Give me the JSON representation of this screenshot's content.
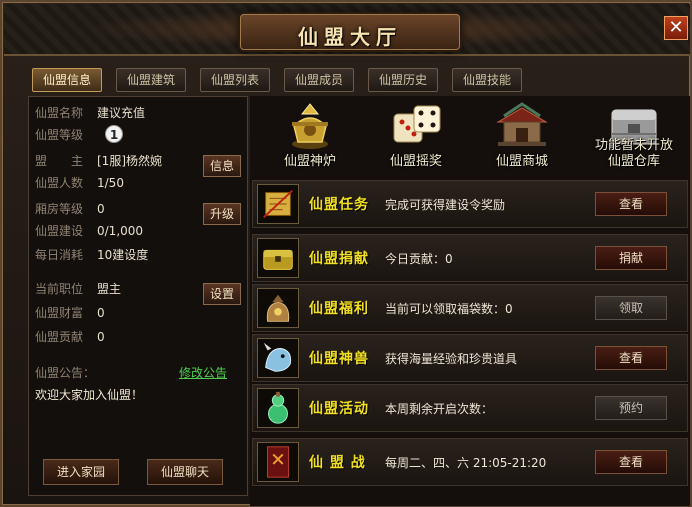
{
  "window": {
    "title": "仙盟大厅",
    "close_label": "✕"
  },
  "tabs": [
    {
      "label": "仙盟信息",
      "active": true
    },
    {
      "label": "仙盟建筑",
      "active": false
    },
    {
      "label": "仙盟列表",
      "active": false
    },
    {
      "label": "仙盟成员",
      "active": false
    },
    {
      "label": "仙盟历史",
      "active": false
    },
    {
      "label": "仙盟技能",
      "active": false
    }
  ],
  "info": {
    "name": {
      "label": "仙盟名称",
      "value": "建议充值"
    },
    "level": {
      "label": "仙盟等级",
      "value": "1"
    },
    "leader": {
      "label": "盟　　主",
      "value": "[1服]杨然婉",
      "button": "信息"
    },
    "members": {
      "label": "仙盟人数",
      "value": "1/50"
    },
    "room_level": {
      "label": "厢房等级",
      "value": "0",
      "button": "升级"
    },
    "construction": {
      "label": "仙盟建设",
      "value": "0/1,000"
    },
    "daily_cost": {
      "label": "每日消耗",
      "value": "10建设度"
    },
    "position": {
      "label": "当前职位",
      "value": "盟主",
      "button": "设置"
    },
    "wealth": {
      "label": "仙盟财富",
      "value": "0"
    },
    "contribution": {
      "label": "仙盟贡献",
      "value": "0"
    },
    "notice": {
      "label": "仙盟公告：",
      "edit_label": "修改公告",
      "text": "欢迎大家加入仙盟！"
    },
    "enter_home_label": "进入家园",
    "chat_label": "仙盟聊天"
  },
  "facilities": [
    {
      "name": "仙盟神炉",
      "icon": "censer-icon"
    },
    {
      "name": "仙盟摇奖",
      "icon": "dice-icon"
    },
    {
      "name": "仙盟商城",
      "icon": "shop-icon"
    },
    {
      "name_line1": "功能暂未开放",
      "name_line2": "仙盟仓库",
      "icon": "warehouse-icon"
    }
  ],
  "features": [
    {
      "name": "仙盟任务",
      "desc": "完成可获得建设令奖励",
      "action": "查看",
      "icon": "scroll-icon",
      "enabled": true
    },
    {
      "name": "仙盟捐献",
      "desc": "今日贡献：0",
      "action": "捐献",
      "icon": "chest-icon",
      "enabled": true
    },
    {
      "name": "仙盟福利",
      "desc": "当前可以领取福袋数：0",
      "action": "领取",
      "icon": "lucky-bag-icon",
      "enabled": false
    },
    {
      "name": "仙盟神兽",
      "desc": "获得海量经验和珍贵道具",
      "action": "查看",
      "icon": "beast-icon",
      "enabled": true
    },
    {
      "name": "仙盟活动",
      "desc": "本周剩余开启次数：",
      "action": "预约",
      "icon": "gourd-icon",
      "enabled": false
    },
    {
      "name": "仙 盟 战",
      "desc": "每周二、四、六 21:05-21:20",
      "action": "查看",
      "icon": "war-book-icon",
      "enabled": true
    }
  ],
  "colors": {
    "accent": "#f2e020",
    "link": "#4ed04e",
    "frame": "#5a4630"
  }
}
